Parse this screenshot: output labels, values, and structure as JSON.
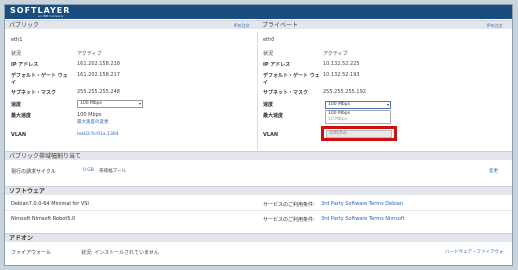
{
  "brand": {
    "logo": "SOFTLAYER",
    "sub": "an IBM Company"
  },
  "public": {
    "title": "パブリック",
    "edit": "IPの注文",
    "iface": "eth1",
    "rows": [
      {
        "label": "状況",
        "value": "アクティブ"
      },
      {
        "label": "IP アドレス",
        "value": "161.202.158.218"
      },
      {
        "label": "デフォルト・ゲート ウェイ",
        "value": "161.202.158.217"
      },
      {
        "label": "サブネット・マスク",
        "value": "255.255.255.248"
      }
    ],
    "speed_label": "速度",
    "speed_value": "100 Mbps",
    "max_speed_label": "最大速度",
    "max_speed_value": "100 Mbps",
    "max_speed_link": "最大速度の変更",
    "vlan_label": "VLAN",
    "vlan_value": "tok02.fcr01a.1364"
  },
  "private": {
    "title": "プライベート",
    "edit": "IPの注文",
    "iface": "eth0",
    "rows": [
      {
        "label": "状況",
        "value": "アクティブ"
      },
      {
        "label": "IP アドレス",
        "value": "10.132.52.225"
      },
      {
        "label": "デフォルト・ゲート ウェイ",
        "value": "10.132.52.193"
      },
      {
        "label": "サブネット・マスク",
        "value": "255.255.255.192"
      }
    ],
    "speed_label": "速度",
    "speed_value": "100 Mbps",
    "dropdown_options": [
      "100 Mbps",
      "10 Mbps"
    ],
    "max_speed_label": "最大速度",
    "vlan_label": "VLAN",
    "disconnect_option": "切断済み"
  },
  "bandwidth": {
    "title": "パブリック帯域幅割り当て",
    "row_label": "現行の請求サイクル",
    "row_value": "0 GB",
    "row_extra": "帯域幅プール",
    "change": "変更"
  },
  "software": {
    "title": "ソフトウェア",
    "rows": [
      {
        "name": "Debian7.0.0-64 Minimal for VSI",
        "terms_label": "サービスのご利用条件:",
        "terms_link": "3rd Party Software Terms Debian"
      },
      {
        "name": "Nimsoft Nimsoft Robot5.0",
        "terms_label": "サービスのご利用条件:",
        "terms_link": "3rd Party Software Terms Nimsoft"
      }
    ]
  },
  "addon": {
    "title": "アドオン",
    "firewall_label": "ファイアウォール",
    "firewall_status": "状況: インストールされていません",
    "firewall_link": "ハードウェア・ファイアウォ"
  },
  "colors": {
    "accent": "#1a4d7d",
    "link": "#2a66b8",
    "highlight": "#d01010"
  }
}
